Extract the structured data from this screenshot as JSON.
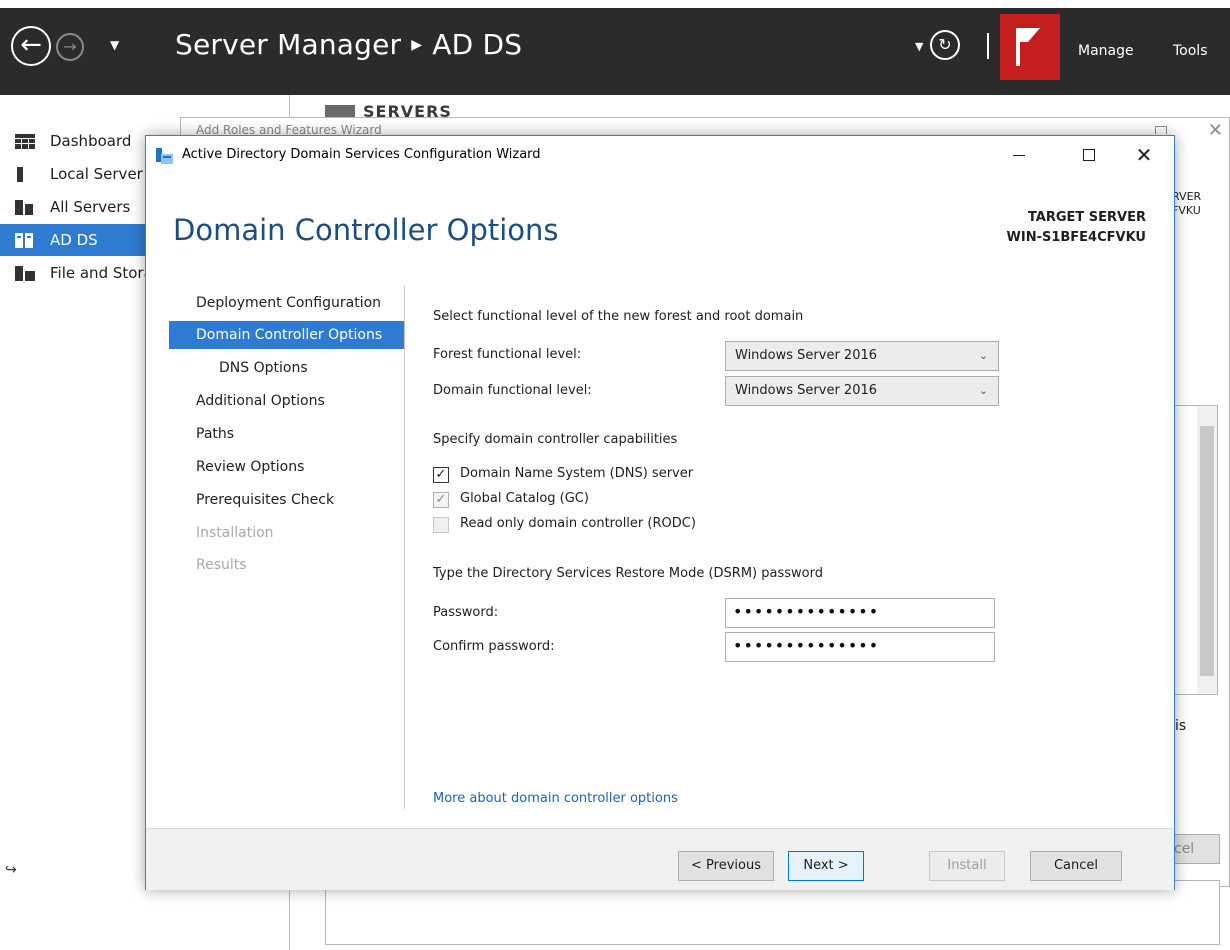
{
  "server_manager": {
    "title": "Server Manager",
    "breadcrumb": "AD DS",
    "menu": {
      "manage": "Manage",
      "tools": "Tools"
    },
    "sidebar": [
      {
        "label": "Dashboard"
      },
      {
        "label": "Local Server"
      },
      {
        "label": "All Servers"
      },
      {
        "label": "AD DS"
      },
      {
        "label": "File and Storage Services"
      }
    ],
    "section_heading": "SERVERS",
    "right_fragment": [
      "RVER",
      "FVKU"
    ],
    "is_fragment": "is",
    "cancel_fragment": "cel"
  },
  "behind_window": {
    "title": "Add Roles and Features Wizard"
  },
  "wizard": {
    "window_title": "Active Directory Domain Services Configuration Wizard",
    "heading": "Domain Controller Options",
    "target_server_label": "TARGET SERVER",
    "target_server_name": "WIN-S1BFE4CFVKU",
    "nav": [
      {
        "label": "Deployment Configuration"
      },
      {
        "label": "Domain Controller Options"
      },
      {
        "label": "DNS Options"
      },
      {
        "label": "Additional Options"
      },
      {
        "label": "Paths"
      },
      {
        "label": "Review Options"
      },
      {
        "label": "Prerequisites Check"
      },
      {
        "label": "Installation"
      },
      {
        "label": "Results"
      }
    ],
    "functional_level_heading": "Select functional level of the new forest and root domain",
    "forest_level_label": "Forest functional level:",
    "forest_level_value": "Windows Server 2016",
    "domain_level_label": "Domain functional level:",
    "domain_level_value": "Windows Server 2016",
    "capabilities_heading": "Specify domain controller capabilities",
    "capabilities": [
      {
        "label": "Domain Name System (DNS) server",
        "checked": true
      },
      {
        "label": "Global Catalog (GC)",
        "checked": true
      },
      {
        "label": "Read only domain controller (RODC)",
        "checked": false
      }
    ],
    "dsrm_heading": "Type the Directory Services Restore Mode (DSRM) password",
    "password_label": "Password:",
    "password_value": "••••••••••••••",
    "confirm_label": "Confirm password:",
    "confirm_value": "••••••••••••••",
    "more_link": "More about domain controller options",
    "buttons": {
      "previous": "< Previous",
      "next": "Next >",
      "install": "Install",
      "cancel": "Cancel"
    }
  },
  "colors": {
    "title_bar": "#2b2b2b",
    "accent": "#2f7bd1",
    "heading": "#1b4e7e",
    "flag": "#c41e1e",
    "link": "#1d62b8"
  }
}
